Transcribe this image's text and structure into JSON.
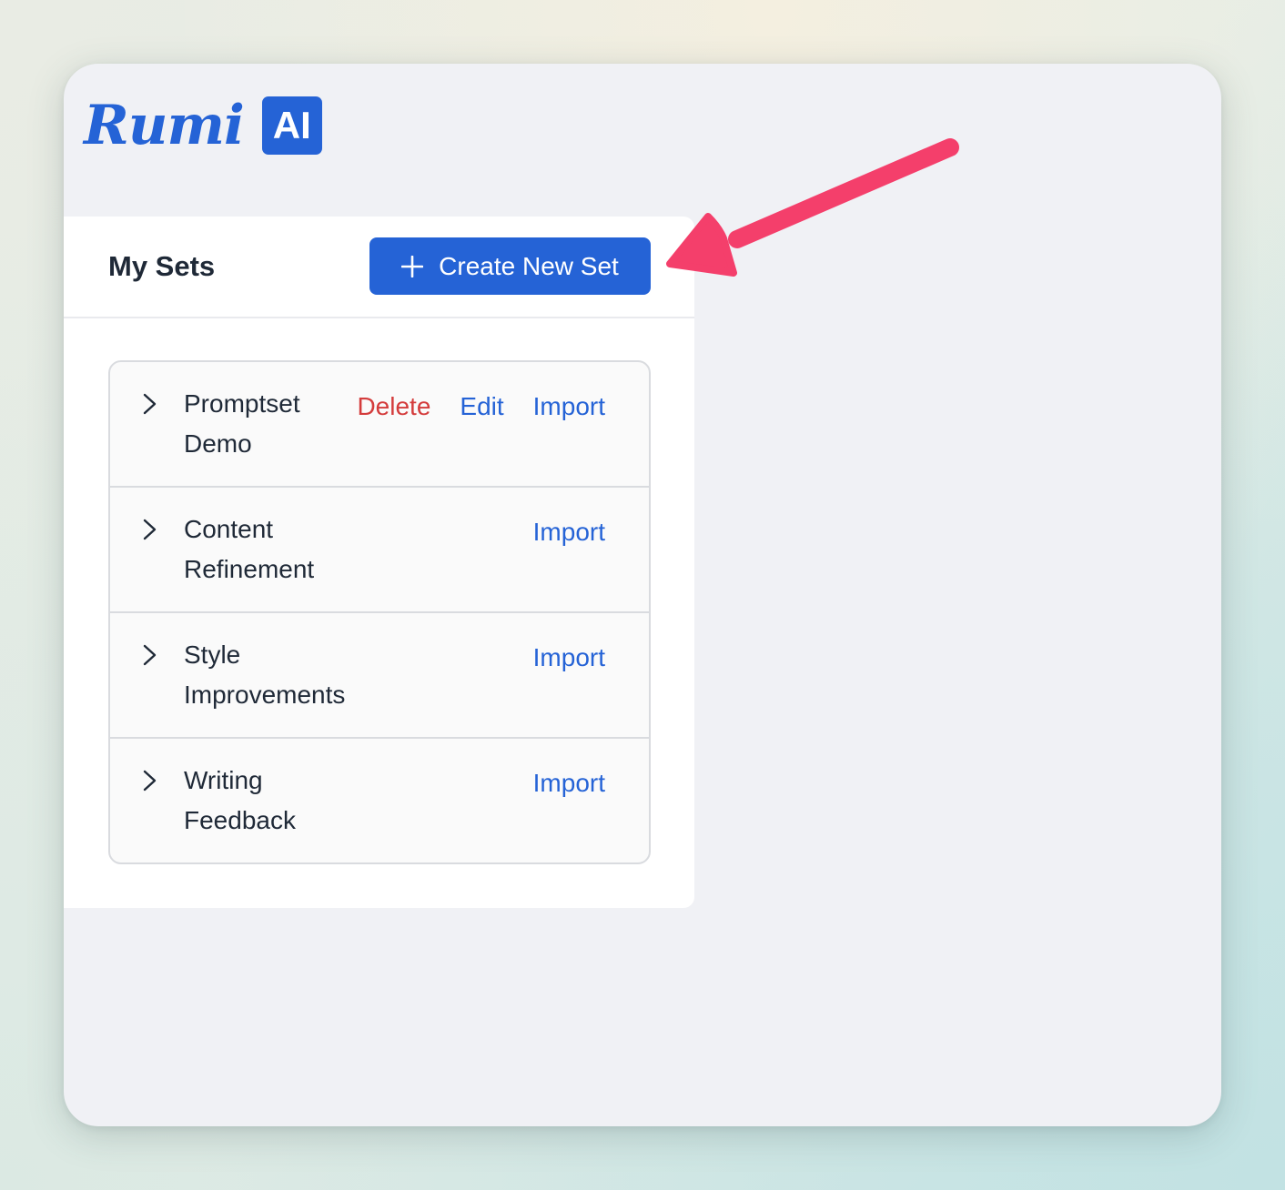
{
  "app": {
    "logo_text": "Rumi",
    "logo_badge": "AI",
    "brand_color": "#2563d6"
  },
  "panel": {
    "title": "My Sets",
    "create_button_label": "Create New Set",
    "create_button_icon": "plus-icon"
  },
  "sets": [
    {
      "name": "Promptset Demo",
      "actions": {
        "delete": "Delete",
        "edit": "Edit",
        "import": "Import"
      }
    },
    {
      "name": "Content Refinement",
      "actions": {
        "import": "Import"
      }
    },
    {
      "name": "Style Improvements",
      "actions": {
        "import": "Import"
      }
    },
    {
      "name": "Writing Feedback",
      "actions": {
        "import": "Import"
      }
    }
  ],
  "colors": {
    "delete": "#d43c3c",
    "link": "#2563d6",
    "annotation_arrow": "#f43f6b"
  }
}
